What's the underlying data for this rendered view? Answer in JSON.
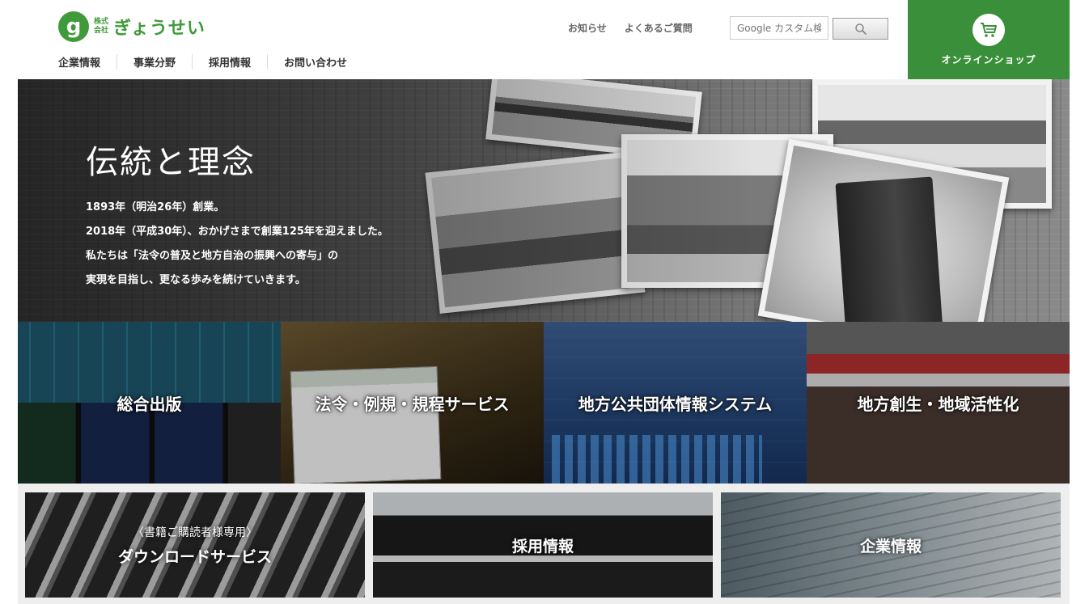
{
  "header": {
    "logo": {
      "mark": "g",
      "small_top": "株式",
      "small_bottom": "会社",
      "name": "ぎょうせい"
    },
    "util_nav": [
      "お知らせ",
      "よくあるご質問"
    ],
    "search": {
      "placeholder": "Google カスタム検"
    },
    "main_nav": [
      "企業情報",
      "事業分野",
      "採用情報",
      "お問い合わせ"
    ],
    "shop_label": "オンラインショップ",
    "accent_color": "#3a8f3a"
  },
  "hero": {
    "title": "伝統と理念",
    "lines": [
      "1893年（明治26年）創業。",
      "2018年（平成30年）、おかげさまで創業125年を迎えました。",
      "私たちは「法令の普及と地方自治の振興への寄与」の",
      "実現を目指し、更なる歩みを続けていきます。"
    ]
  },
  "categories": [
    "総合出版",
    "法令・例規・規程サービス",
    "地方公共団体情報システム",
    "地方創生・地域活性化"
  ],
  "tiles": [
    {
      "sub": "〈書籍ご購読者様専用〉",
      "label": "ダウンロードサービス"
    },
    {
      "label": "採用情報"
    },
    {
      "label": "企業情報"
    }
  ]
}
